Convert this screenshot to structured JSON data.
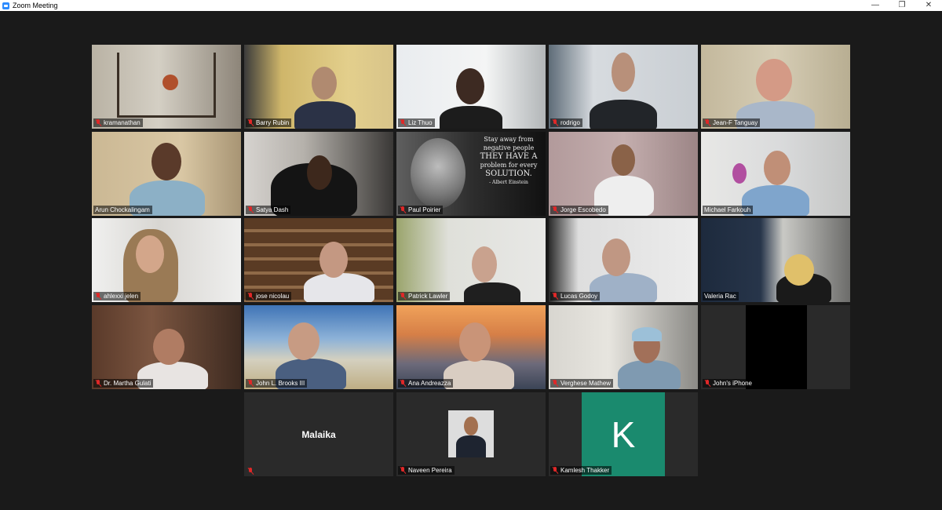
{
  "window": {
    "title": "Zoom Meeting",
    "minimize_glyph": "—",
    "restore_glyph": "❐",
    "close_glyph": "✕"
  },
  "participants": [
    {
      "name": "kramanathan"
    },
    {
      "name": "Barry Rubin"
    },
    {
      "name": "Liz Thuo"
    },
    {
      "name": "rodrigo"
    },
    {
      "name": "Jean-F Tanguay"
    },
    {
      "name": "Arun Chockalingam"
    },
    {
      "name": "Satya Dash"
    },
    {
      "name": "Paul Poirier"
    },
    {
      "name": "Jorge Escobedo"
    },
    {
      "name": "Michael Farkouh"
    },
    {
      "name": "ahlexxi jelen"
    },
    {
      "name": "jose nicolau"
    },
    {
      "name": "Patrick Lawler"
    },
    {
      "name": "Lucas Godoy"
    },
    {
      "name": "Valeria Rac"
    },
    {
      "name": "Dr. Martha Gulati"
    },
    {
      "name": "John L. Brooks III"
    },
    {
      "name": "Ana Andreazza"
    },
    {
      "name": "Verghese Mathew"
    },
    {
      "name": "John's iPhone"
    },
    {
      "name": "Malaika",
      "display_name": "Malaika"
    },
    {
      "name": "Naveen Pereira"
    },
    {
      "name": "Kamlesh Thakker",
      "avatar_letter": "K"
    }
  ],
  "einstein_quote": {
    "lines": [
      "Stay away from",
      "negative people",
      "THEY HAVE A",
      "problem for every",
      "SOLUTION.",
      "- Albert Einstein"
    ]
  },
  "colors": {
    "active_speaker_border": "#e4e05a",
    "muted_icon": "#e02828",
    "avatar_k_bg": "#1a8a6e"
  }
}
